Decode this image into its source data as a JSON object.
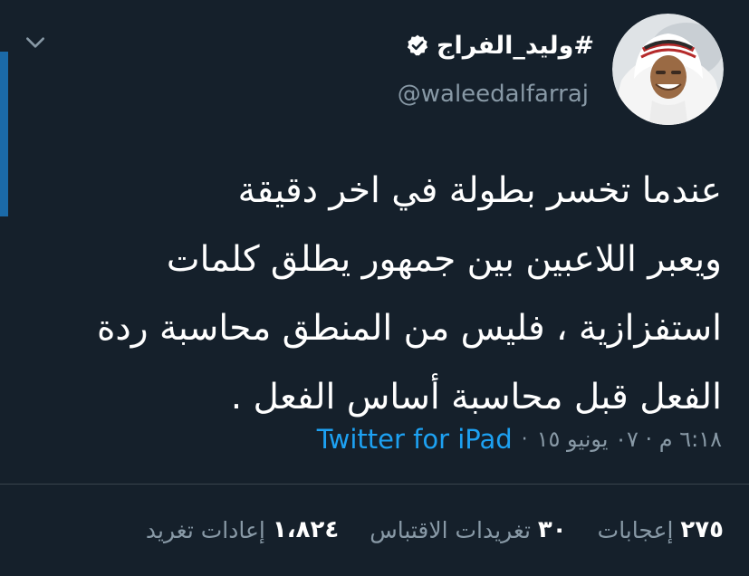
{
  "colors": {
    "background": "#15202b",
    "accent": "#1da1f2",
    "muted": "#8899a6",
    "divider": "#38444d",
    "side_bar": "#1b6aa8"
  },
  "icons": {
    "menu": "chevron-down-icon",
    "verified": "verified-badge-icon",
    "avatar": "avatar"
  },
  "tweet": {
    "display_name": "#وليد_الفراج",
    "handle": "@waleedalfarraj",
    "body_lines": [
      "عندما تخسر بطولة في اخر دقيقة",
      "ويعبر اللاعبين بين جمهور يطلق كلمات",
      "استفزازية ، فليس من المنطق محاسبة ردة",
      "الفعل قبل محاسبة أساس الفعل ."
    ],
    "timestamp": "٦:١٨ م · ٠٧ يونيو ١٥",
    "separator": "·",
    "source": "Twitter for iPad"
  },
  "stats": {
    "retweets": {
      "count": "١،٨٢٤",
      "label": "إعادات تغريد"
    },
    "quotes": {
      "count": "٣٠",
      "label": "تغريدات الاقتباس"
    },
    "likes": {
      "count": "٢٧٥",
      "label": "إعجابات"
    }
  }
}
